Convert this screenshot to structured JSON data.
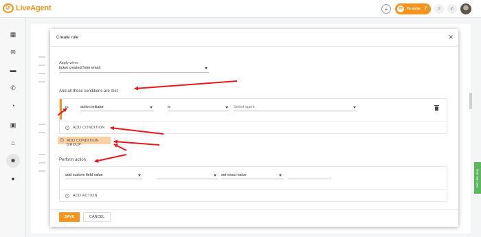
{
  "app": {
    "logo_text": "LiveAgent",
    "logo_mark": "Q!",
    "accent_color": "#f7941d",
    "solve_label": "To solve",
    "solve_count": "7"
  },
  "modal": {
    "title": "Create rule",
    "apply_label": "Apply when",
    "apply_value": "ticket created from email",
    "conditions_heading": "And all these conditions are met",
    "if_label": "IF",
    "condition_field": "action initiator",
    "condition_operator": "is",
    "condition_value_placeholder": "Select agent",
    "add_condition_label": "ADD CONDITION",
    "add_condition_group_label": "ADD CONDITION GROUP",
    "perform_heading": "Perform action",
    "action_field": "add custom field value",
    "action_mode": "set exact value",
    "add_action_label": "ADD ACTION",
    "save_label": "SAVE",
    "cancel_label": "CANCEL"
  },
  "help_tab": "Get Live Help",
  "annotation_color": "#e8191c"
}
